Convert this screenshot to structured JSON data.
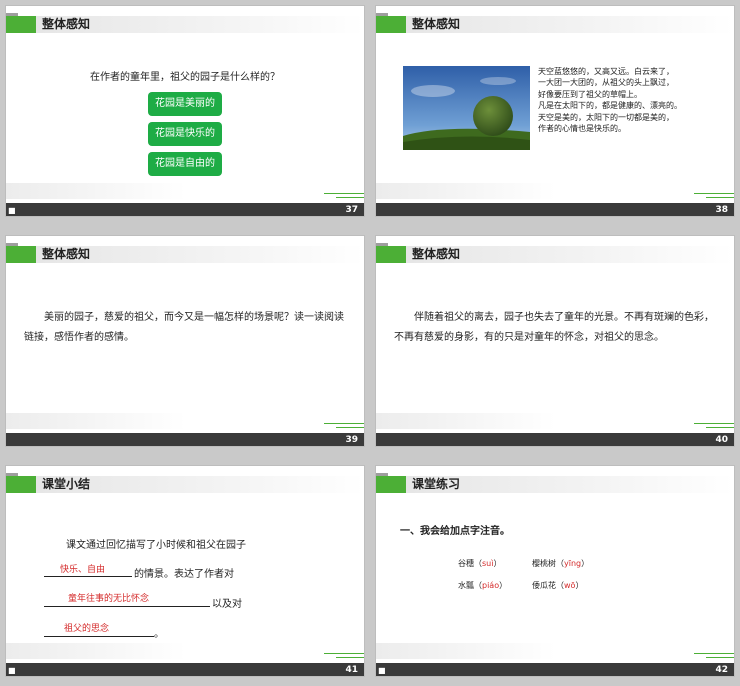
{
  "slides": {
    "s37": {
      "title": "整体感知",
      "question": "在作者的童年里，祖父的园子是什么样的？",
      "buttons": [
        "花园是美丽的",
        "花园是快乐的",
        "花园是自由的"
      ],
      "page": "37",
      "icon": "ppt-icon"
    },
    "s38": {
      "title": "整体感知",
      "lines": [
        "天空蓝悠悠的，又高又远。白云来了，",
        "一大团一大团的，从祖父的头上飘过，",
        "好像要压到了祖父的草帽上。",
        "凡是在太阳下的，都是健康的、漂亮的。",
        "天空是美的，太阳下的一切都是美的，",
        "作者的心情也是快乐的。"
      ],
      "page": "38",
      "icon": "ppt-icon"
    },
    "s39": {
      "title": "整体感知",
      "paragraph": "美丽的园子，慈爱的祖父，而今又是一幅怎样的场景呢？读一读阅读链接，感悟作者的感情。",
      "page": "39",
      "icon": "ppt-icon"
    },
    "s40": {
      "title": "整体感知",
      "paragraph": "伴随着祖父的离去，园子也失去了童年的光景。不再有斑斓的色彩，不再有慈爱的身影，有的只是对童年的怀念，对祖父的思念。",
      "page": "40",
      "icon": "ppt-icon"
    },
    "s41": {
      "title": "课堂小结",
      "line1": "课文通过回忆描写了小时候和祖父在园子",
      "ans1": "快乐、自由",
      "line2": "的情景。表达了作者对",
      "ans2": "童年往事的无比怀念",
      "line3": "以及对",
      "ans3": "祖父的思念",
      "end": "。",
      "page": "41",
      "icon": "ppt-icon"
    },
    "s42": {
      "title": "课堂练习",
      "exercise": "一、我会给加点字注音。",
      "items": [
        {
          "word": "谷穗",
          "py": "suì"
        },
        {
          "word": "樱桃树",
          "py": "yīng"
        },
        {
          "word": "水瓢",
          "py": "piáo"
        },
        {
          "word": "倭瓜花",
          "py": "wō"
        }
      ],
      "page": "42",
      "icon": "ppt-icon"
    }
  },
  "colors": {
    "accent": "#4caf36",
    "button": "#1eac45",
    "answer": "#d42a2a"
  }
}
